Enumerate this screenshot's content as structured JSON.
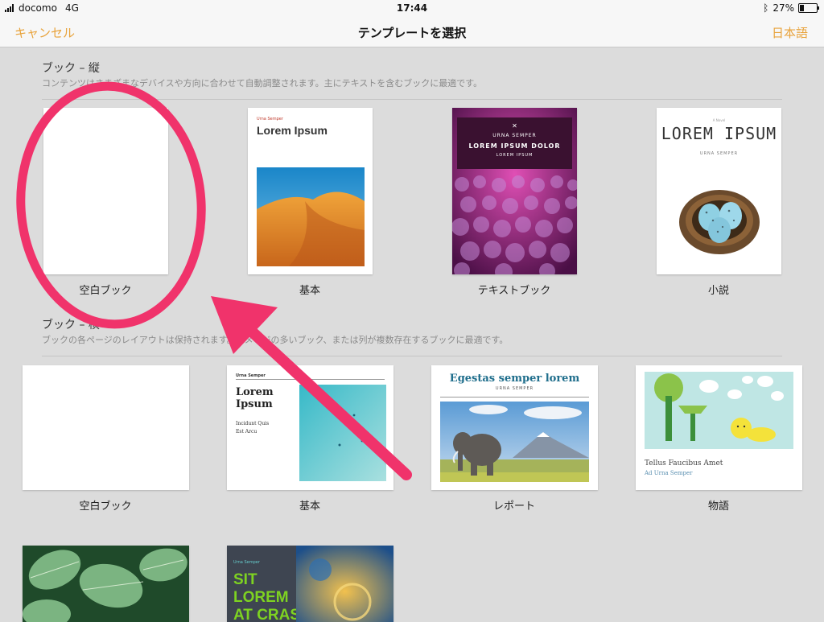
{
  "status_bar": {
    "carrier": "docomo",
    "network": "4G",
    "time": "17:44",
    "battery_text": "27%",
    "battery_level": 0.27
  },
  "nav": {
    "cancel_label": "キャンセル",
    "title": "テンプレートを選択",
    "language_label": "日本語"
  },
  "accent_color": "#e8a33c",
  "annotation_color": "#f0336b",
  "sections": [
    {
      "title": "ブック – 縦",
      "description": "コンテンツはさまざまなデバイスや方向に合わせて自動調整されます。主にテキストを含むブックに最適です。",
      "templates": [
        {
          "label": "空白ブック"
        },
        {
          "label": "基本",
          "cover_small": "Urna Semper",
          "cover_title": "Lorem Ipsum"
        },
        {
          "label": "テキストブック",
          "cover_line1": "URNA SEMPER",
          "cover_line2": "LOREM IPSUM DOLOR",
          "cover_line3": "LOREM IPSUM"
        },
        {
          "label": "小説",
          "cover_small": "A Novel",
          "cover_title": "LOREM IPSUM",
          "cover_sub": "URNA SEMPER"
        }
      ]
    },
    {
      "title": "ブック – 横",
      "description": "ブックの各ページのレイアウトは保持されます。イメージの多いブック、または列が複数存在するブックに最適です。",
      "templates": [
        {
          "label": "空白ブック"
        },
        {
          "label": "基本",
          "cover_small": "Urna Semper",
          "cover_title_1": "Lorem",
          "cover_title_2": "Ipsum",
          "cover_sub_1": "Incidunt Quis",
          "cover_sub_2": "Est Arcu"
        },
        {
          "label": "レポート",
          "cover_title": "Egestas semper lorem",
          "cover_sub": "URNA SEMPER"
        },
        {
          "label": "物語",
          "cover_title": "Tellus Faucibus Amet",
          "cover_sub": "Ad Urna Semper"
        }
      ]
    },
    {
      "templates": [
        {
          "label": ""
        },
        {
          "label": "",
          "cover_small": "Urna Semper",
          "cover_title_1": "SIT",
          "cover_title_2": "LOREM",
          "cover_title_3": "AT CRAS"
        }
      ]
    }
  ]
}
